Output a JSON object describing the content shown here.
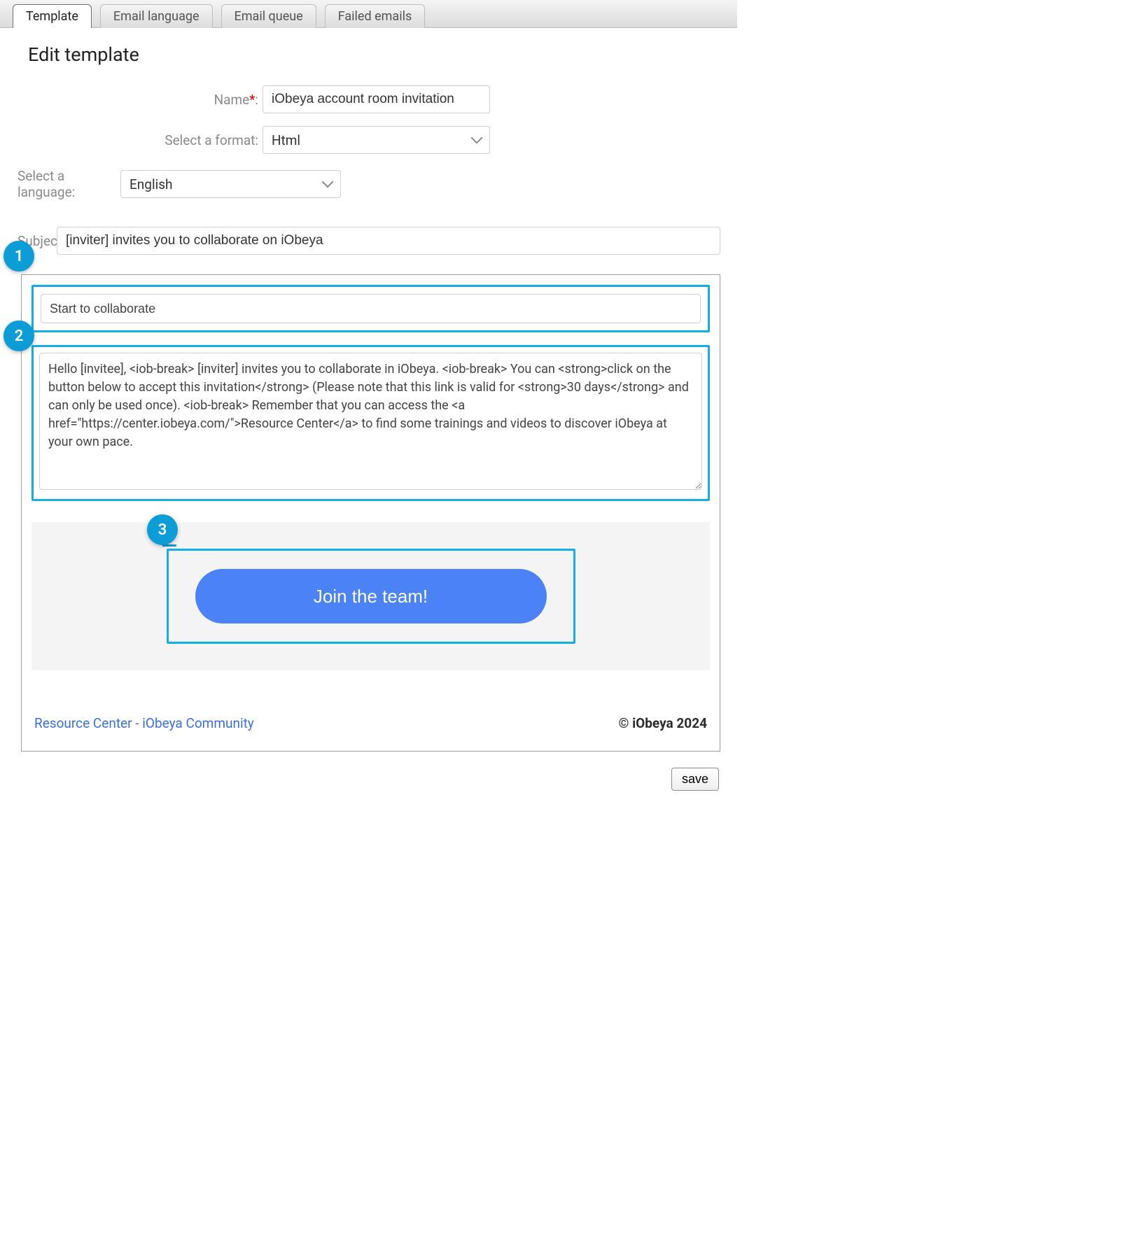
{
  "tabs": [
    "Template",
    "Email language",
    "Email queue",
    "Failed emails"
  ],
  "active_tab_index": 0,
  "page_title": "Edit template",
  "form": {
    "name_label": "Name",
    "name_required_mark": "*",
    "name_colon": ":",
    "name_value": "iObeya account room invitation",
    "format_label": "Select a format:",
    "format_value": "Html",
    "language_label": "Select a language:",
    "language_value": "English",
    "subject_label": "Subject:",
    "subject_value": "[inviter] invites you to collaborate on iObeya"
  },
  "editor": {
    "badge1": "1",
    "badge2": "2",
    "badge3": "3",
    "title_value": "Start to collaborate",
    "body_value": "Hello [invitee], <iob-break> [inviter] invites you to collaborate in iObeya. <iob-break> You can <strong>click on the button below to accept this invitation</strong> (Please note that this link is valid for <strong>30 days</strong> and can only be used once). <iob-break> Remember that you can access the <a href=\"https://center.iobeya.com/\">Resource Center</a> to find some trainings and videos to discover iObeya at your own pace.",
    "cta_label": "Join the team!"
  },
  "footer": {
    "link1": "Resource Center",
    "sep": " - ",
    "link2": "iObeya Community",
    "copyright": "© iObeya 2024"
  },
  "save_label": "save"
}
